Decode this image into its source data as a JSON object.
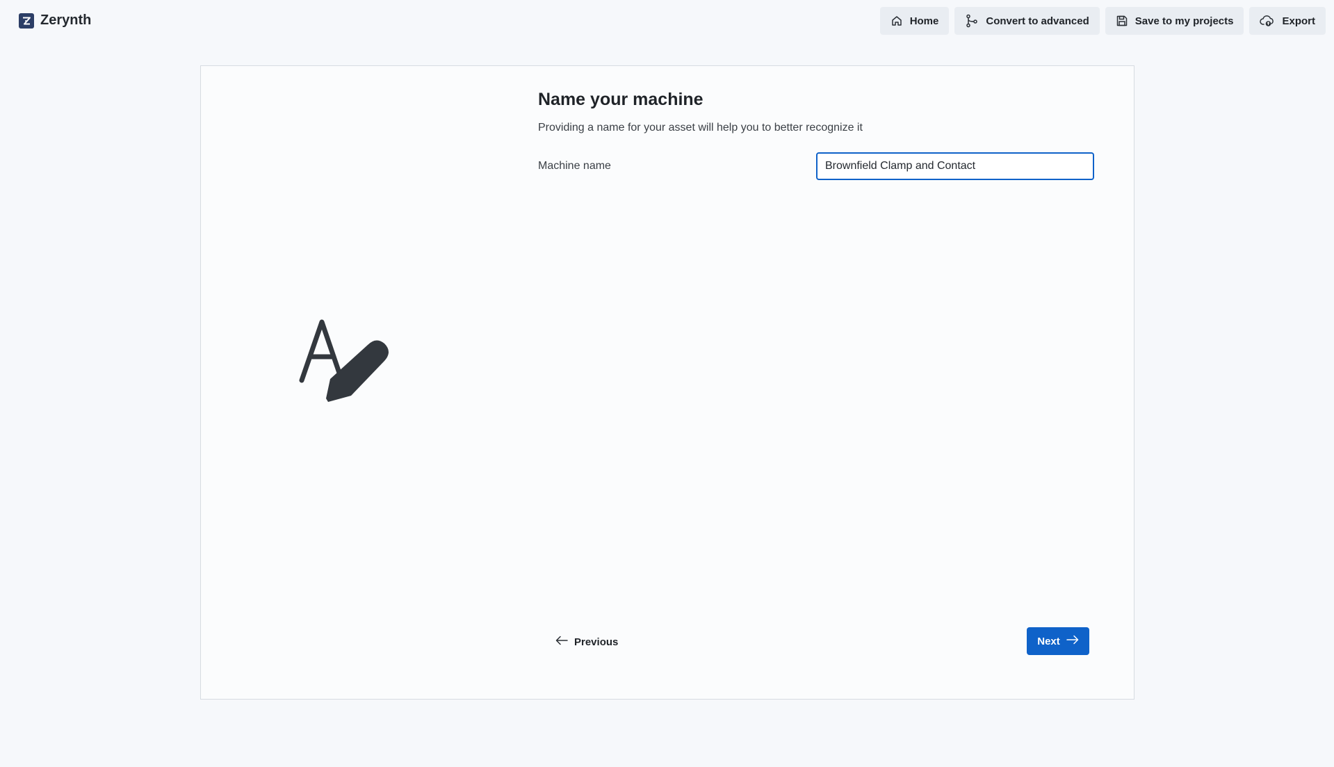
{
  "header": {
    "brand_name": "Zerynth",
    "brand_logo_icon": "zerynth-logo-icon",
    "nav": [
      {
        "label": "Home",
        "icon": "home-icon"
      },
      {
        "label": "Convert to advanced",
        "icon": "git-branch-icon"
      },
      {
        "label": "Save to my projects",
        "icon": "floppy-disk-icon"
      },
      {
        "label": "Export",
        "icon": "cloud-export-icon"
      }
    ]
  },
  "wizard": {
    "illustration_icon": "text-edit-icon",
    "title": "Name your machine",
    "subtitle": "Providing a name for your asset will help you to better recognize it",
    "machine_name_label": "Machine name",
    "machine_name_value": "Brownfield Clamp and Contact",
    "previous_label": "Previous",
    "next_label": "Next"
  },
  "colors": {
    "accent": "#0f62c9",
    "background": "#f6f8fb",
    "nav_button_bg": "#e9edf2",
    "brand_logo_bg": "#2c3e66"
  }
}
